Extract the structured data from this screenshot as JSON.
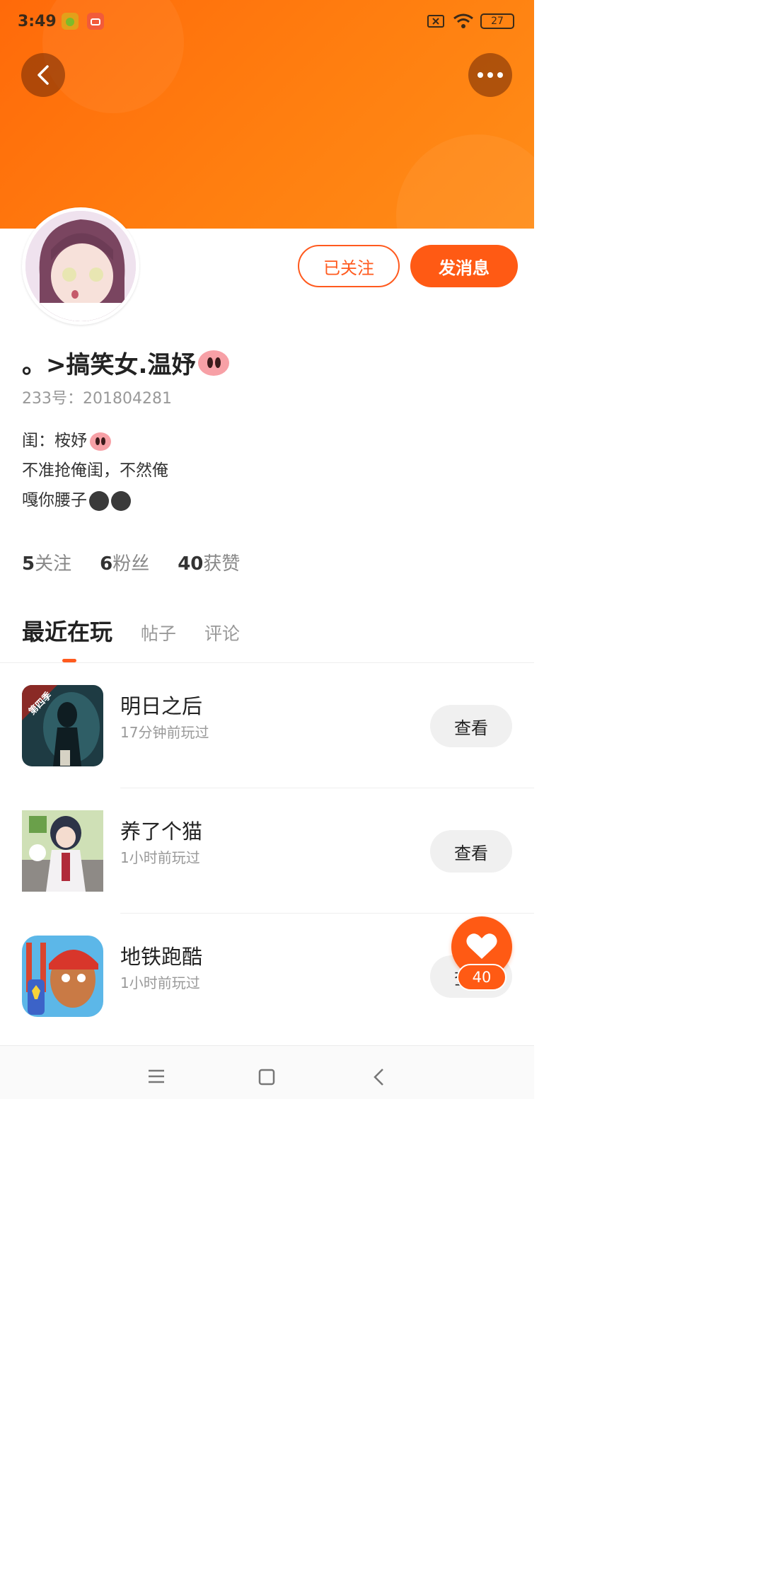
{
  "status_bar": {
    "time": "3:49",
    "battery": "27"
  },
  "profile": {
    "name": "。>搞笑女.温妤",
    "uid": "233号：201804281",
    "bio_lines": [
      "闺：桉妤",
      "不准抢俺闺，不然俺",
      "嘎你腰子"
    ],
    "follow_label": "已关注",
    "message_label": "发消息",
    "stats": {
      "following_count": "5",
      "following_label": "关注",
      "fans_count": "6",
      "fans_label": "粉丝",
      "likes_count": "40",
      "likes_label": "获赞"
    }
  },
  "tabs": [
    "最近在玩",
    "帖子",
    "评论"
  ],
  "games": [
    {
      "name": "明日之后",
      "time": "17分钟前玩过",
      "button": "查看",
      "badge": "第四季"
    },
    {
      "name": "养了个猫",
      "time": "1小时前玩过",
      "button": "查看"
    },
    {
      "name": "地铁跑酷",
      "time": "1小时前玩过",
      "button": "查看"
    }
  ],
  "like_fab": {
    "count": "40"
  },
  "colors": {
    "accent": "#ff5a14",
    "header_gradient_start": "#ff6a0a",
    "header_gradient_end": "#ff8d18"
  },
  "icons": [
    "back-arrow-icon",
    "more-icon",
    "heart-icon",
    "menu-icon",
    "home-square-icon",
    "nav-back-icon",
    "wifi-icon",
    "battery-icon",
    "sim-off-icon"
  ]
}
